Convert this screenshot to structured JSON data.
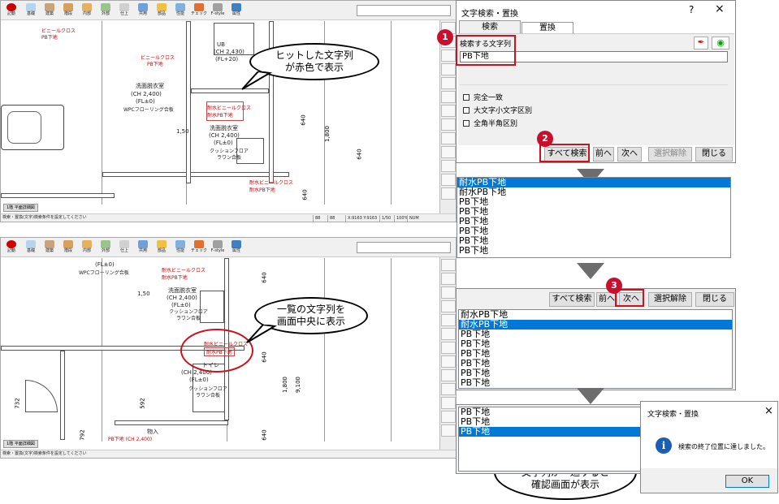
{
  "cad_top": {
    "toolbar": [
      "基礎",
      "建築",
      "階段",
      "内部",
      "外部",
      "仕上",
      "共用",
      "部品",
      "性能",
      "チェック",
      "F-style",
      "属性"
    ],
    "text_labels": [
      "ビニールクロス",
      "PB下地",
      "ビニールクロス",
      "PB下地",
      "UB",
      "(CH 2,430)",
      "(FL+20)",
      "洗面脱衣室",
      "(CH 2,400)",
      "(FL±0)",
      "WPCフローリング合板",
      "耐水ビニールクロス",
      "耐水PB下地",
      "洗面脱衣室",
      "(CH 2,400)",
      "(FL±0)",
      "クッションフロアラワン合板",
      "耐水ビニールクロス",
      "耐水PB下地",
      "1,50"
    ],
    "dims": [
      "640",
      "1,800",
      "640",
      "640",
      "640"
    ],
    "status": "検索・置換(文字)検索条件を設定してください",
    "view_tab": "1階 平面詳細図",
    "status_cells": [
      "88",
      "88",
      "X:9163 Y:9163",
      "1/50",
      "100%",
      "NUM"
    ]
  },
  "cad_bottom": {
    "text_labels": [
      "(FL±0)",
      "耐水ビニールクロス",
      "耐水PB下地",
      "WPCフローリング合板",
      "1,50",
      "洗面脱衣室",
      "(CH 2,400)",
      "(FL±0)",
      "クッションフロアラワン合板",
      "耐水ビニールクロス",
      "耐水PB下地",
      "トイレ",
      "(CH 2,400)",
      "(FL±0)",
      "クッションフロアラワン合板",
      "物入",
      "PB下地 (CH 2,400)"
    ],
    "dims": [
      "640",
      "640",
      "1,800",
      "9,100",
      "640",
      "592",
      "732",
      "792"
    ],
    "status": "検索・置換(文字)検索条件を設定してください",
    "view_tab": "1階 平面詳細図"
  },
  "callouts": {
    "c1": "ヒットした文字列\nが赤色で表示",
    "c2": "一覧の文字列を\n画面中央に表示",
    "c3": "「次へ」「前へ」で\n文字列が一巡すると\n確認画面が表示"
  },
  "badges": [
    "1",
    "2",
    "3"
  ],
  "dialog": {
    "title": "文字検索・置換",
    "help": "?",
    "close": "×",
    "tab_search": "検索",
    "tab_replace": "置換",
    "search_label": "検索する文字列",
    "search_value": "PB下地",
    "options": [
      "完全一致",
      "大文字小文字区別",
      "全角半角区別"
    ],
    "buttons": {
      "search_all": "すべて検索",
      "prev": "前へ",
      "next": "次へ",
      "deselect": "選択解除",
      "close": "閉じる"
    }
  },
  "list1": [
    "耐水PB下地",
    "耐水PB下地",
    "PB下地",
    "PB下地",
    "PB下地",
    "PB下地",
    "PB下地",
    "PB下地"
  ],
  "list2": [
    "耐水PB下地",
    "耐水PB下地",
    "PB下地",
    "PB下地",
    "PB下地",
    "PB下地",
    "PB下地",
    "PB下地"
  ],
  "list3": [
    "PB下地",
    "PB下地",
    "PB下地"
  ],
  "msgbox": {
    "title": "文字検索・置換",
    "close": "×",
    "message": "検索の終了位置に達しました。",
    "ok": "OK"
  }
}
